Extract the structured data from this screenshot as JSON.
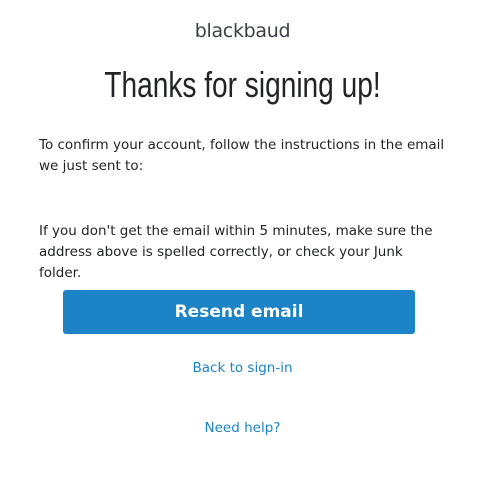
{
  "brand": {
    "logo_text": "blackbaud"
  },
  "heading": "Thanks for signing up!",
  "instructions": {
    "confirm_text": "To confirm your account, follow the instructions in the email we just sent to:",
    "junk_text": "If you don't get the email within 5 minutes, make sure the address above is spelled correctly, or check your Junk folder."
  },
  "actions": {
    "resend_label": "Resend email",
    "back_label": "Back to sign-in",
    "help_label": "Need help?"
  },
  "colors": {
    "accent": "#1c84c6",
    "text": "#212327",
    "logo": "#3d4149"
  }
}
